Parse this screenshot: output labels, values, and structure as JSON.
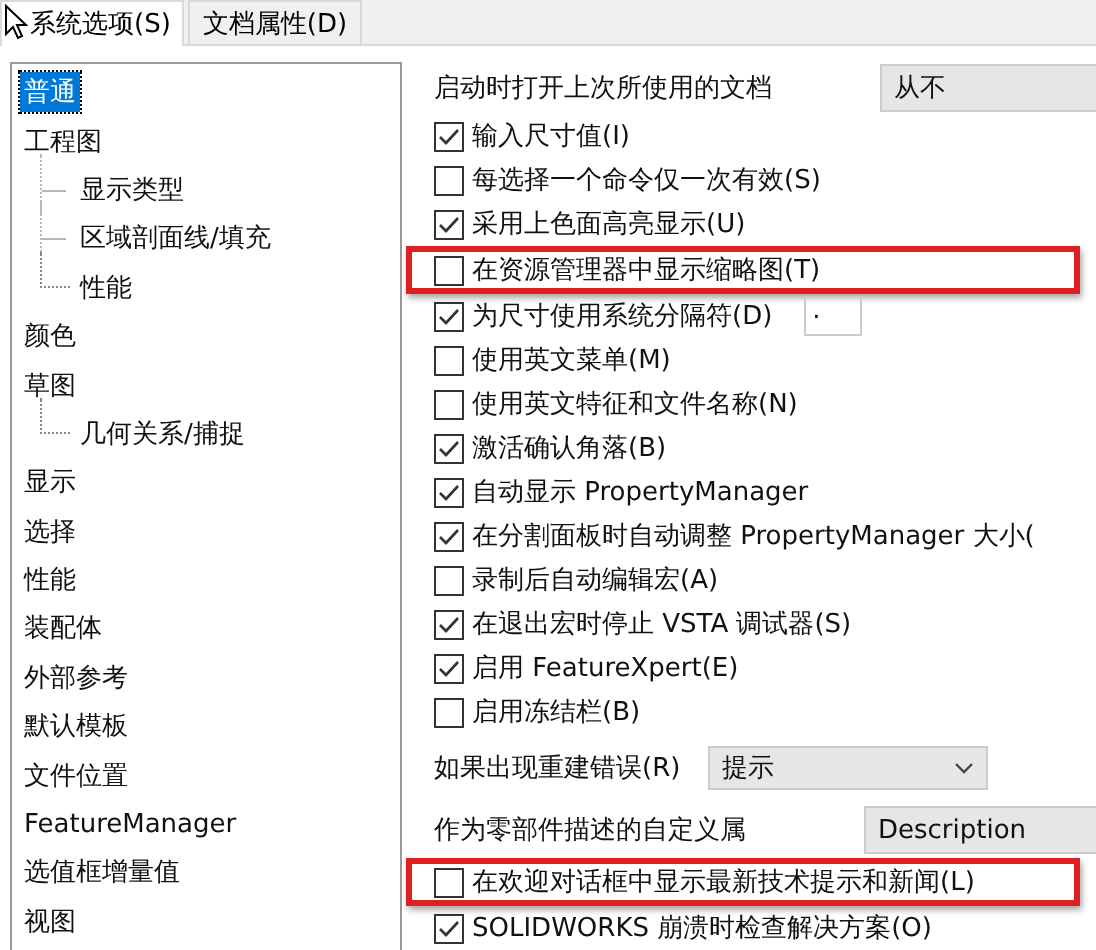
{
  "tabs": [
    {
      "label": "系统选项(S)",
      "selected": true
    },
    {
      "label": "文档属性(D)",
      "selected": false
    }
  ],
  "tree": {
    "items": [
      {
        "label": "普通",
        "selected": true
      },
      {
        "label": "工程图",
        "selected": false,
        "children": [
          {
            "label": "显示类型",
            "selected": false
          },
          {
            "label": "区域剖面线/填充",
            "selected": false
          },
          {
            "label": "性能",
            "selected": false
          }
        ]
      },
      {
        "label": "颜色",
        "selected": false
      },
      {
        "label": "草图",
        "selected": false,
        "children": [
          {
            "label": "几何关系/捕捉",
            "selected": false
          }
        ]
      },
      {
        "label": "显示",
        "selected": false
      },
      {
        "label": "选择",
        "selected": false
      },
      {
        "label": "性能",
        "selected": false
      },
      {
        "label": "装配体",
        "selected": false
      },
      {
        "label": "外部参考",
        "selected": false
      },
      {
        "label": "默认模板",
        "selected": false
      },
      {
        "label": "文件位置",
        "selected": false
      },
      {
        "label": "FeatureManager",
        "selected": false
      },
      {
        "label": "选值框增量值",
        "selected": false
      },
      {
        "label": "视图",
        "selected": false
      }
    ]
  },
  "options": [
    {
      "kind": "select",
      "label": "启动时打开上次所使用的文档",
      "value": "从不"
    },
    {
      "kind": "checkbox",
      "label": "输入尺寸值(I)",
      "checked": true,
      "highlighted": false
    },
    {
      "kind": "checkbox",
      "label": "每选择一个命令仅一次有效(S)",
      "checked": false,
      "highlighted": false
    },
    {
      "kind": "checkbox",
      "label": "采用上色面高亮显示(U)",
      "checked": true,
      "highlighted": false
    },
    {
      "kind": "checkbox",
      "label": "在资源管理器中显示缩略图(T)",
      "checked": false,
      "highlighted": true
    },
    {
      "kind": "checkbox",
      "label": "为尺寸使用系统分隔符(D)",
      "checked": true,
      "highlighted": false,
      "field": "."
    },
    {
      "kind": "checkbox",
      "label": "使用英文菜单(M)",
      "checked": false,
      "highlighted": false
    },
    {
      "kind": "checkbox",
      "label": "使用英文特征和文件名称(N)",
      "checked": false,
      "highlighted": false
    },
    {
      "kind": "checkbox",
      "label": "激活确认角落(B)",
      "checked": true,
      "highlighted": false
    },
    {
      "kind": "checkbox",
      "label": "自动显示 PropertyManager",
      "checked": true,
      "highlighted": false
    },
    {
      "kind": "checkbox",
      "label": "在分割面板时自动调整 PropertyManager 大小(",
      "checked": true,
      "highlighted": false
    },
    {
      "kind": "checkbox",
      "label": "录制后自动编辑宏(A)",
      "checked": false,
      "highlighted": false
    },
    {
      "kind": "checkbox",
      "label": "在退出宏时停止 VSTA 调试器(S)",
      "checked": true,
      "highlighted": false
    },
    {
      "kind": "checkbox",
      "label": "启用 FeatureXpert(E)",
      "checked": true,
      "highlighted": false
    },
    {
      "kind": "checkbox",
      "label": "启用冻结栏(B)",
      "checked": false,
      "highlighted": false
    },
    {
      "kind": "dropdown",
      "label": "如果出现重建错误(R)",
      "value": "提示"
    },
    {
      "kind": "select",
      "label": "作为零部件描述的自定义属",
      "value": "Description"
    },
    {
      "kind": "checkbox",
      "label": "在欢迎对话框中显示最新技术提示和新闻(L)",
      "checked": false,
      "highlighted": true
    },
    {
      "kind": "checkbox",
      "label": "SOLIDWORKS 崩溃时检查解决方案(O)",
      "checked": true,
      "highlighted": false
    }
  ]
}
